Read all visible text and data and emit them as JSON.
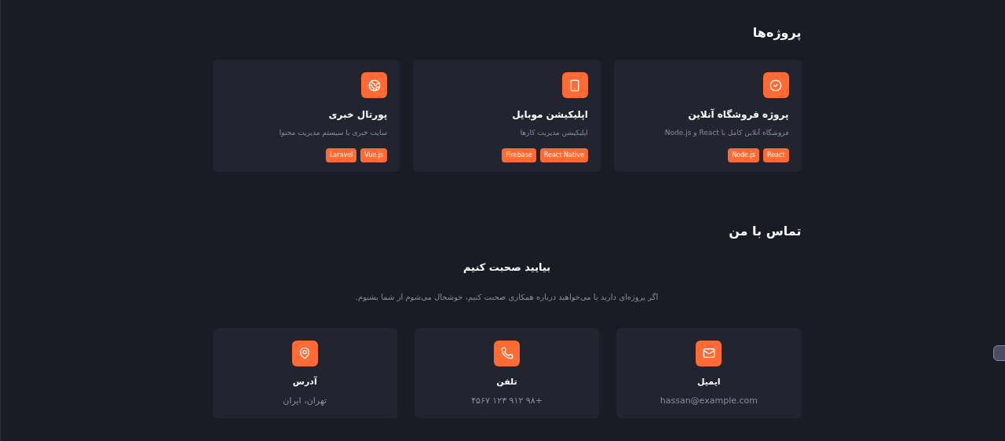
{
  "projects": {
    "title": "پروژه‌ها",
    "items": [
      {
        "title": "پروژه فروشگاه آنلاین",
        "description": "فروشگاه آنلاین کامل با React و Node.js",
        "tags": [
          "React",
          "Node.js"
        ]
      },
      {
        "title": "اپلیکیشن موبایل",
        "description": "اپلیکیشن مدیریت کارها",
        "tags": [
          "React Native",
          "Firebase"
        ]
      },
      {
        "title": "پورتال خبری",
        "description": "سایت خبری با سیستم مدیریت محتوا",
        "tags": [
          "Vue.js",
          "Laravel"
        ]
      }
    ]
  },
  "contact": {
    "title": "تماس با من",
    "heading": "بیایید صحبت کنیم",
    "text": "اگر پروژه‌ای دارید یا می‌خواهید درباره همکاری صحبت کنیم، خوشحال می‌شوم از شما بشنوم.",
    "items": [
      {
        "label": "ایمیل",
        "value": "hassan@example.com"
      },
      {
        "label": "تلفن",
        "value": "+۹۸ ۹۱۲ ۱۲۳ ۴۵۶۷"
      },
      {
        "label": "آدرس",
        "value": "تهران، ایران"
      }
    ]
  }
}
